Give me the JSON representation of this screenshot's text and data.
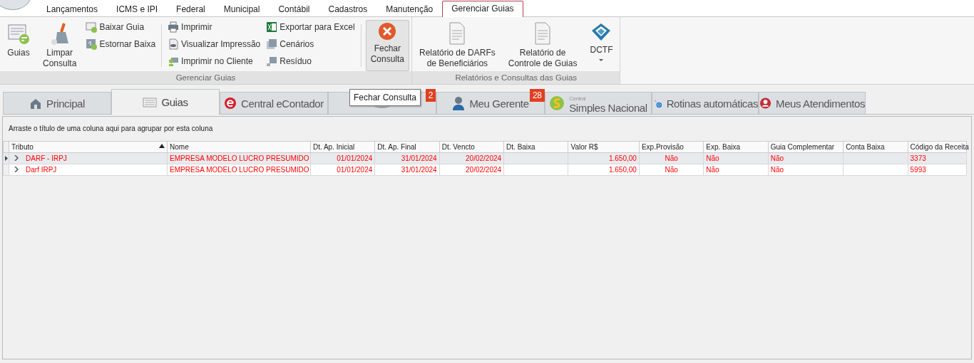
{
  "menu": [
    {
      "label": "Lançamentos",
      "selected": false
    },
    {
      "label": "ICMS e IPI",
      "selected": false
    },
    {
      "label": "Federal",
      "selected": false
    },
    {
      "label": "Municipal",
      "selected": false
    },
    {
      "label": "Contábil",
      "selected": false
    },
    {
      "label": "Cadastros",
      "selected": false
    },
    {
      "label": "Manutenção",
      "selected": false
    },
    {
      "label": "Gerenciar Guias",
      "selected": true
    }
  ],
  "ribbon": {
    "groups": [
      {
        "title": "Gerenciar Guias",
        "items": [
          {
            "kind": "large",
            "lines": [
              "Guias"
            ],
            "hovered": false
          },
          {
            "kind": "large",
            "lines": [
              "Limpar",
              "Consulta"
            ],
            "hovered": false
          },
          {
            "kind": "stack",
            "buttons": [
              "Baixar Guia",
              "Estornar Baixa"
            ]
          },
          {
            "kind": "separator"
          },
          {
            "kind": "stack",
            "buttons": [
              "Imprimir",
              "Visualizar Impressão",
              "Imprimir no Cliente"
            ]
          },
          {
            "kind": "stack",
            "buttons": [
              "Exportar para Excel",
              "Cenários",
              "Resíduo"
            ]
          },
          {
            "kind": "separator"
          },
          {
            "kind": "large",
            "lines": [
              "Fechar",
              "Consulta"
            ],
            "hovered": true
          }
        ]
      },
      {
        "title": "Relatórios e Consultas das Guias",
        "items": [
          {
            "kind": "large",
            "lines": [
              "Relatório de DARFs",
              "de Beneficiários"
            ],
            "hovered": false
          },
          {
            "kind": "large",
            "lines": [
              "Relatório de",
              "Controle de Guias"
            ],
            "hovered": false
          },
          {
            "kind": "large",
            "lines": [
              "DCTF"
            ],
            "hovered": false,
            "dropdown": true
          }
        ]
      }
    ]
  },
  "tabs": [
    {
      "label": "Principal",
      "selected": false
    },
    {
      "label": "Guias",
      "selected": true
    },
    {
      "label": "Central eContador",
      "selected": false
    },
    {
      "selected": false,
      "badge": "2"
    },
    {
      "label": "Meu Gerente",
      "selected": false,
      "badge": "28"
    },
    {
      "caption": "Central",
      "label": "Simples Nacional",
      "selected": false
    },
    {
      "label": "Rotinas automáticas",
      "selected": false
    },
    {
      "label": "Meus Atendimentos",
      "selected": false
    }
  ],
  "tooltip": "Fechar Consulta",
  "grid": {
    "group_hint": "Arraste o título de uma coluna aqui para agrupar por esta coluna",
    "columns": [
      {
        "label": "Tributo",
        "sorted": true
      },
      {
        "label": "Nome",
        "sorted": false
      },
      {
        "label": "Dt. Ap. Inicial",
        "sorted": false
      },
      {
        "label": "Dt. Ap. Final",
        "sorted": false
      },
      {
        "label": "Dt. Vencto",
        "sorted": false
      },
      {
        "label": "Dt. Baixa",
        "sorted": false
      },
      {
        "label": "Valor R$",
        "sorted": false
      },
      {
        "label": "Exp.Provisão",
        "sorted": false
      },
      {
        "label": "Exp. Baixa",
        "sorted": false
      },
      {
        "label": "Guia Complementar",
        "sorted": false
      },
      {
        "label": "Conta Baixa",
        "sorted": false
      },
      {
        "label": "Código da Receita",
        "sorted": false
      }
    ],
    "rows": [
      {
        "selected": true,
        "cells": [
          "DARF - IRPJ",
          "EMPRESA MODELO LUCRO PRESUMIDO",
          "01/01/2024",
          "31/01/2024",
          "20/02/2024",
          "",
          "1.650,00",
          "Não",
          "Não",
          "Não",
          "",
          "3373"
        ]
      },
      {
        "selected": false,
        "cells": [
          "Darf IRPJ",
          "EMPRESA MODELO LUCRO PRESUMIDO",
          "01/01/2024",
          "31/01/2024",
          "20/02/2024",
          "",
          "1.650,00",
          "Não",
          "Não",
          "Não",
          "",
          "5993"
        ]
      }
    ]
  }
}
